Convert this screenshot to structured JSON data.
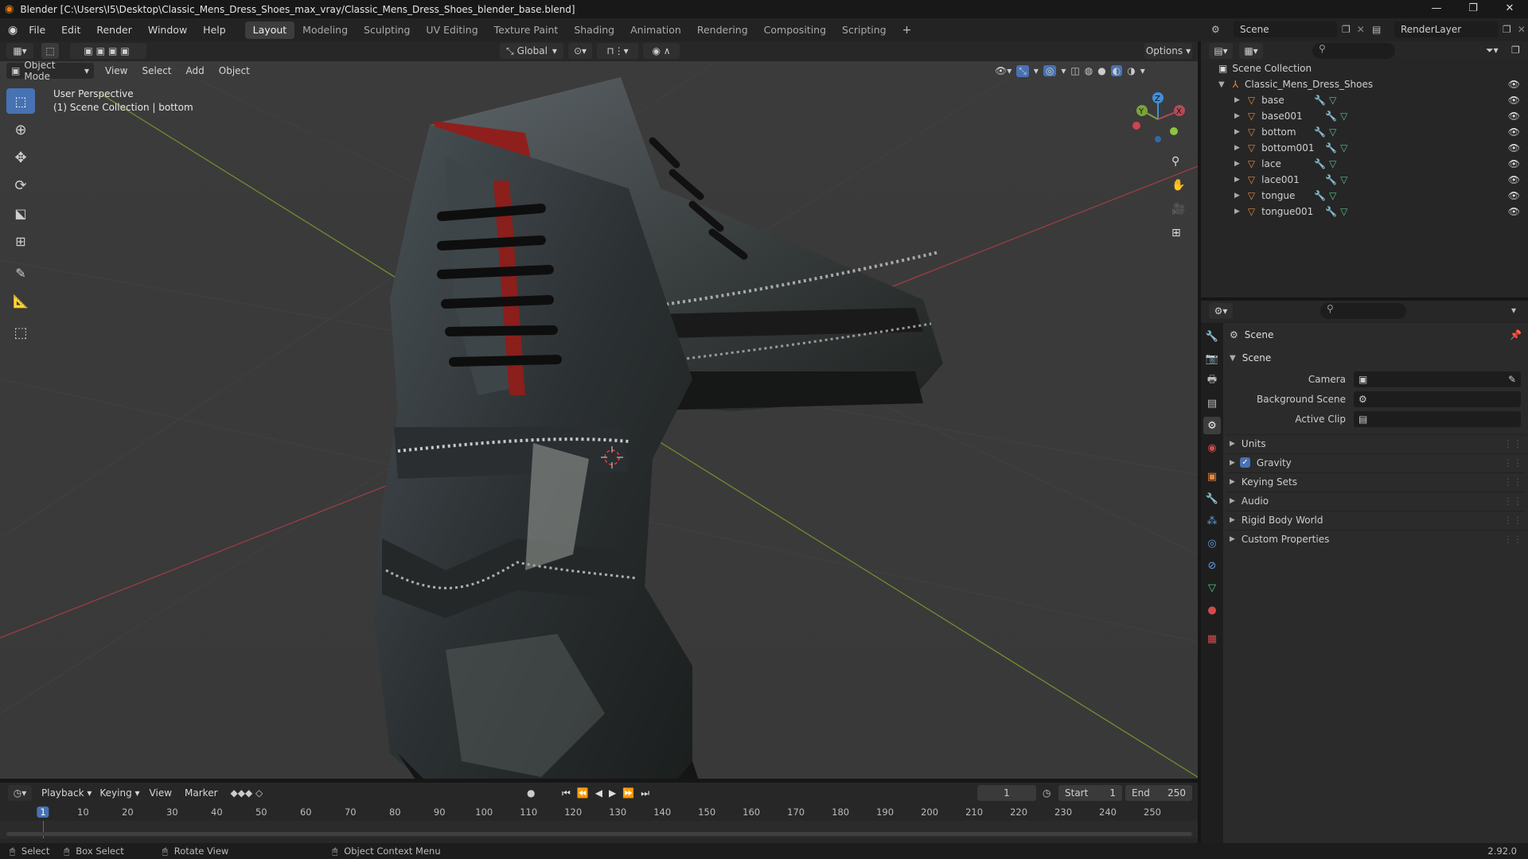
{
  "window": {
    "title": "Blender [C:\\Users\\I5\\Desktop\\Classic_Mens_Dress_Shoes_max_vray/Classic_Mens_Dress_Shoes_blender_base.blend]",
    "minimize": "—",
    "maximize": "❐",
    "close": "✕"
  },
  "menu": [
    "File",
    "Edit",
    "Render",
    "Window",
    "Help"
  ],
  "workspaces": [
    "Layout",
    "Modeling",
    "Sculpting",
    "UV Editing",
    "Texture Paint",
    "Shading",
    "Animation",
    "Rendering",
    "Compositing",
    "Scripting"
  ],
  "add_workspace": "+",
  "scene_selector": "Scene",
  "view_layer": "RenderLayer",
  "viewport": {
    "transform_orientation": "Global",
    "options": "Options",
    "mode": "Object Mode",
    "header_menus": [
      "View",
      "Select",
      "Add",
      "Object"
    ],
    "perspective": "User Perspective",
    "collection_info": "(1) Scene Collection | bottom",
    "gizmo": {
      "x": "X",
      "y": "Y",
      "z": "Z"
    }
  },
  "outliner": {
    "root": "Scene Collection",
    "collection": "Classic_Mens_Dress_Shoes",
    "objects": [
      "base",
      "base001",
      "bottom",
      "bottom001",
      "lace",
      "lace001",
      "tongue",
      "tongue001"
    ]
  },
  "properties": {
    "header": "Scene",
    "panel": "Scene",
    "fields": [
      {
        "label": "Camera",
        "value": ""
      },
      {
        "label": "Background Scene",
        "value": ""
      },
      {
        "label": "Active Clip",
        "value": ""
      }
    ],
    "subpanels": [
      "Units",
      "Gravity",
      "Keying Sets",
      "Audio",
      "Rigid Body World",
      "Custom Properties"
    ],
    "gravity_enabled": true
  },
  "timeline": {
    "menus": [
      "Playback",
      "Keying",
      "View",
      "Marker"
    ],
    "current_frame": "1",
    "start_label": "Start",
    "start": "1",
    "end_label": "End",
    "end": "250",
    "ticks": [
      "1",
      "10",
      "20",
      "30",
      "40",
      "50",
      "60",
      "70",
      "80",
      "90",
      "100",
      "110",
      "120",
      "130",
      "140",
      "150",
      "160",
      "170",
      "180",
      "190",
      "200",
      "210",
      "220",
      "230",
      "240",
      "250"
    ]
  },
  "status": {
    "select": "Select",
    "box_select": "Box Select",
    "rotate_view": "Rotate View",
    "context_menu": "Object Context Menu",
    "version": "2.92.0"
  },
  "colors": {
    "accent": "#4772b3",
    "x_axis": "#b34b55",
    "y_axis": "#7aa33a",
    "z_axis": "#3f8fdc",
    "object_icon": "#e8883a",
    "mesh_icon": "#58c08a"
  }
}
